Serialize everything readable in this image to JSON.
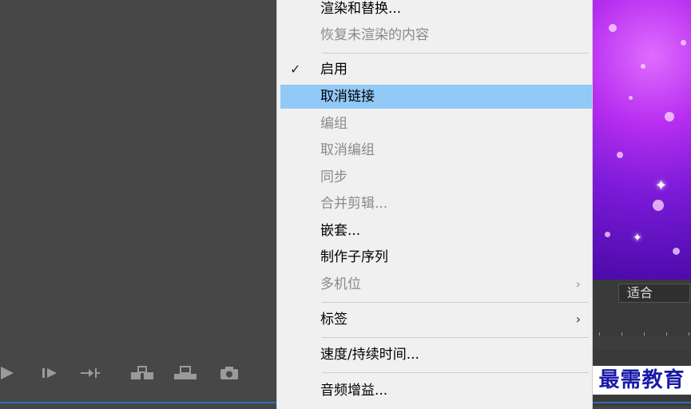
{
  "menu": {
    "items": [
      {
        "label": "渲染和替换...",
        "enabled": true
      },
      {
        "label": "恢复未渲染的内容",
        "enabled": false
      },
      {
        "label": "启用",
        "enabled": true,
        "checked": true
      },
      {
        "label": "取消链接",
        "enabled": true,
        "highlighted": true
      },
      {
        "label": "编组",
        "enabled": false
      },
      {
        "label": "取消编组",
        "enabled": false
      },
      {
        "label": "同步",
        "enabled": false
      },
      {
        "label": "合并剪辑...",
        "enabled": false
      },
      {
        "label": "嵌套...",
        "enabled": true
      },
      {
        "label": "制作子序列",
        "enabled": true
      },
      {
        "label": "多机位",
        "enabled": false,
        "submenu": true
      },
      {
        "label": "标签",
        "enabled": true,
        "submenu": true
      },
      {
        "label": "速度/持续时间...",
        "enabled": true
      },
      {
        "label": "音频增益...",
        "enabled": true
      }
    ],
    "check_glyph": "✓",
    "submenu_glyph": "›",
    "highlight_color": "#91c9f7"
  },
  "preview": {
    "fit_label": "适合"
  },
  "transport": {
    "icons": [
      "play-icon",
      "step-forward-icon",
      "go-to-out-icon",
      "insert-icon",
      "overwrite-icon",
      "export-frame-icon"
    ]
  },
  "watermark": {
    "text": "最需教育"
  }
}
